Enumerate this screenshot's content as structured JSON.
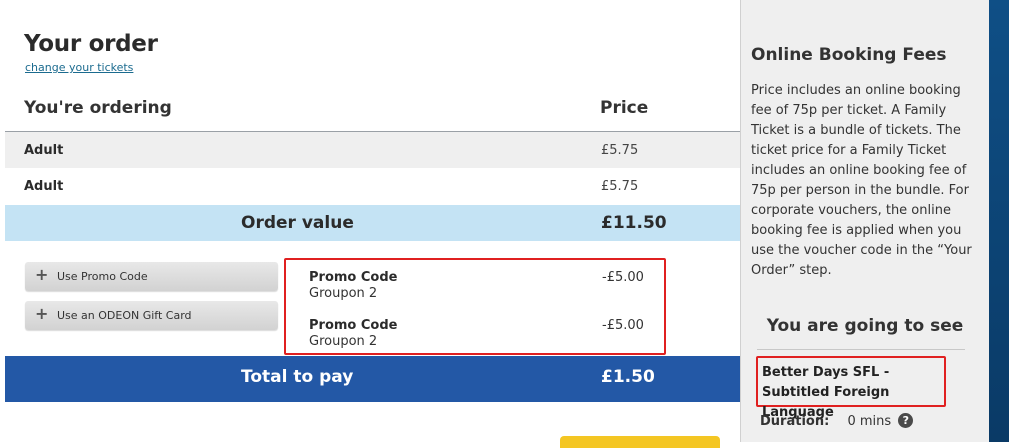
{
  "order": {
    "title": "Your order",
    "change_link": "change your tickets",
    "col_ordering": "You're ordering",
    "col_price": "Price",
    "tickets": [
      {
        "name": "Adult",
        "price": "£5.75"
      },
      {
        "name": "Adult",
        "price": "£5.75"
      }
    ],
    "order_value_label": "Order value",
    "order_value": "£11.50",
    "promo_button_label": "Use Promo Code",
    "giftcard_button_label": "Use an ODEON Gift Card",
    "promos": [
      {
        "name": "Promo Code",
        "desc": "Groupon 2",
        "amount": "-£5.00"
      },
      {
        "name": "Promo Code",
        "desc": "Groupon 2",
        "amount": "-£5.00"
      }
    ],
    "total_label": "Total to pay",
    "total_value": "£1.50"
  },
  "sidebar": {
    "fees_title": "Online Booking Fees",
    "fees_text": "Price includes an online booking fee of 75p per ticket. A Family Ticket is a bundle of tickets. The ticket price for a Family Ticket includes an online booking fee of 75p per person in the bundle. For corporate vouchers, the online booking fee is applied when you use the voucher code in the “Your Order” step.",
    "going_title": "You are going to see",
    "film_title": "Better Days SFL - Subtitled Foreign Language",
    "duration_label": "Duration:",
    "duration_value": "0 mins",
    "help_glyph": "?"
  },
  "colors": {
    "order_value_bg": "#c4e3f4",
    "total_bg": "#2358a6",
    "highlight_border": "#e02020",
    "continue_button": "#f4c623"
  }
}
